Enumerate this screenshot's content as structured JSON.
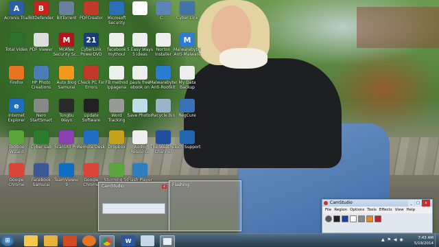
{
  "desktop_icons": [
    {
      "label": "Acronis Trial",
      "glyph": "A",
      "color": "#2a5fa8"
    },
    {
      "label": "BitDefender",
      "glyph": "B",
      "color": "#c8251d"
    },
    {
      "label": "BitTorrent",
      "glyph": "",
      "color": "#6a7f99"
    },
    {
      "label": "PDFCreator",
      "glyph": "",
      "color": "#c23a2a"
    },
    {
      "label": "Microsoft Security",
      "glyph": "",
      "color": "#2b6fb8"
    },
    {
      "label": "",
      "glyph": "",
      "color": "#fff"
    },
    {
      "label": "C...",
      "glyph": "",
      "color": "#5b85b4"
    },
    {
      "label": "Cyber Link",
      "glyph": "",
      "color": "#4473a9"
    },
    {
      "label": "Total Video",
      "glyph": "",
      "color": "#2d6f2f"
    },
    {
      "label": "PDF Viewer",
      "glyph": "",
      "color": "#ddd"
    },
    {
      "label": "McAfee Security Sc...",
      "glyph": "M",
      "color": "#b3141a"
    },
    {
      "label": "CyberLink PowerDVD",
      "glyph": "21",
      "color": "#1a3e78"
    },
    {
      "label": "facebook mythoul",
      "glyph": "",
      "color": "#eee"
    },
    {
      "label": "5 Easy Ways 5 ideas",
      "glyph": "",
      "color": "#eee"
    },
    {
      "label": "Norton Installer",
      "glyph": "",
      "color": "#eee"
    },
    {
      "label": "Malwarebytes Anti-Malware",
      "glyph": "M",
      "color": "#2b7cd3"
    },
    {
      "label": "Firefox",
      "glyph": "",
      "color": "#e87320"
    },
    {
      "label": "HP Photo Creations",
      "glyph": "",
      "color": "#4a7db8"
    },
    {
      "label": "Auto Blog Samurai",
      "glyph": "",
      "color": "#f39a1c"
    },
    {
      "label": "Check PC For Errors",
      "glyph": "",
      "color": "#c4382a"
    },
    {
      "label": "FB method Ippagena",
      "glyph": "",
      "color": "#eee"
    },
    {
      "label": "pauls free ebook on",
      "glyph": "",
      "color": "#eee"
    },
    {
      "label": "Malwarebytes Anti-Rootkit",
      "glyph": "",
      "color": "#2b7cd3"
    },
    {
      "label": "My Data Backup",
      "glyph": "",
      "color": "#eee"
    },
    {
      "label": "Internet Explorer",
      "glyph": "e",
      "color": "#1f6dc1"
    },
    {
      "label": "Nero StartSmart",
      "glyph": "",
      "color": "#888"
    },
    {
      "label": "Tongbu Wayn",
      "glyph": "",
      "color": "#2a2a2a"
    },
    {
      "label": "Update Software",
      "glyph": "",
      "color": "#222"
    },
    {
      "label": "Word Tracking",
      "glyph": "",
      "color": "#999"
    },
    {
      "label": "Save Photos",
      "glyph": "",
      "color": "#c0dbe8"
    },
    {
      "label": "Recycle Bin",
      "glyph": "",
      "color": "#9bb4c8"
    },
    {
      "label": "RegCure",
      "glyph": "",
      "color": "#3a74b8"
    },
    {
      "label": "Toolbox Wizard",
      "glyph": "",
      "color": "#5aa63c"
    },
    {
      "label": "Cyber Lab",
      "glyph": "",
      "color": "#2b7c2b"
    },
    {
      "label": "ScanUtil Pro",
      "glyph": "",
      "color": "#8a3fb4"
    },
    {
      "label": "Remote Desk",
      "glyph": "",
      "color": "#1f70c5"
    },
    {
      "label": "Dropbox",
      "glyph": "",
      "color": "#c8a21a"
    },
    {
      "label": "Audio Resource",
      "glyph": "",
      "color": "#eee"
    },
    {
      "label": "The Weather Channel",
      "glyph": "",
      "color": "#1f4f9e"
    },
    {
      "label": "Tech Support",
      "glyph": "",
      "color": "#2266b0"
    },
    {
      "label": "Google Chrome",
      "glyph": "",
      "color": "#db4437"
    },
    {
      "label": "Facebook Samurai",
      "glyph": "",
      "color": "#3b5998"
    },
    {
      "label": "TeamViewer 9",
      "glyph": "",
      "color": "#0e6ec5"
    },
    {
      "label": "Google Chrome",
      "glyph": "",
      "color": "#db4437"
    },
    {
      "label": "Stunning SC",
      "glyph": "",
      "color": "#5aa63c"
    },
    {
      "label": "Flash Player",
      "glyph": "",
      "color": "#2d7dc0"
    }
  ],
  "thumbnails": [
    {
      "title": "CamStudio",
      "close": "x"
    },
    {
      "title": "Flashing",
      "close": ""
    }
  ],
  "camstudio": {
    "title": "CamStudio",
    "menu": [
      "File",
      "Region",
      "Options",
      "Tools",
      "Effects",
      "View",
      "Help"
    ],
    "window_buttons": [
      "_",
      "□",
      "x"
    ]
  },
  "taskbar": {
    "start": "⊞",
    "items": [
      "Explorer",
      "Media Player",
      "Firefox",
      "Chrome",
      "Word",
      "Files",
      "Active Window"
    ],
    "tray": "▲ ⚑ ◀ ◉",
    "time": "7:43 AM",
    "date": "5/19/2014"
  }
}
